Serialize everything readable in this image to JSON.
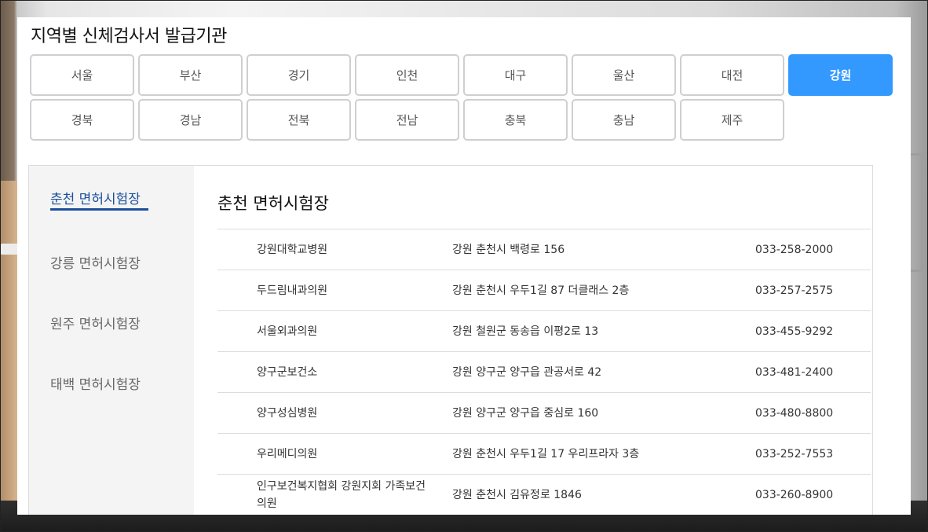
{
  "page_title": "지역별 신체검사서 발급기관",
  "regions": [
    {
      "label": "서울",
      "active": false
    },
    {
      "label": "부산",
      "active": false
    },
    {
      "label": "경기",
      "active": false
    },
    {
      "label": "인천",
      "active": false
    },
    {
      "label": "대구",
      "active": false
    },
    {
      "label": "울산",
      "active": false
    },
    {
      "label": "대전",
      "active": false
    },
    {
      "label": "강원",
      "active": true
    },
    {
      "label": "경북",
      "active": false
    },
    {
      "label": "경남",
      "active": false
    },
    {
      "label": "전북",
      "active": false
    },
    {
      "label": "전남",
      "active": false
    },
    {
      "label": "충북",
      "active": false
    },
    {
      "label": "충남",
      "active": false
    },
    {
      "label": "제주",
      "active": false
    }
  ],
  "sidebar": {
    "items": [
      {
        "label": "춘천 면허시험장",
        "active": true
      },
      {
        "label": "강릉 면허시험장",
        "active": false
      },
      {
        "label": "원주 면허시험장",
        "active": false
      },
      {
        "label": "태백 면허시험장",
        "active": false
      }
    ]
  },
  "section": {
    "title": "춘천 면허시험장",
    "rows": [
      {
        "name": "강원대학교병원",
        "address": "강원 춘천시 백령로 156",
        "phone": "033-258-2000"
      },
      {
        "name": "두드림내과의원",
        "address": "강원 춘천시 우두1길 87 더클래스 2층",
        "phone": "033-257-2575"
      },
      {
        "name": "서울외과의원",
        "address": "강원 철원군 동송읍 이평2로 13",
        "phone": "033-455-9292"
      },
      {
        "name": "양구군보건소",
        "address": "강원 양구군 양구읍 관공서로 42",
        "phone": "033-481-2400"
      },
      {
        "name": "양구성심병원",
        "address": "강원 양구군 양구읍 중심로 160",
        "phone": "033-480-8800"
      },
      {
        "name": "우리메디의원",
        "address": "강원 춘천시 우두1길 17 우리프라자 3층",
        "phone": "033-252-7553"
      },
      {
        "name": "인구보건복지협회 강원지회 가족보건의원",
        "address": "강원 춘천시 김유정로 1846",
        "phone": "033-260-8900"
      }
    ]
  },
  "colors": {
    "accent": "#3399ff",
    "sidebar_active": "#1c4f9c"
  }
}
